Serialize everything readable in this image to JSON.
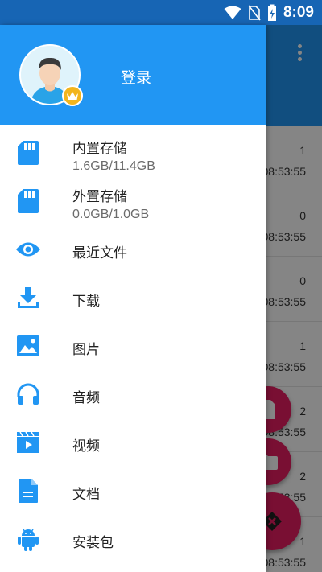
{
  "status_bar": {
    "time": "8:09",
    "icons": [
      "wifi-icon",
      "no-sim-icon",
      "battery-charging-icon"
    ]
  },
  "colors": {
    "primary": "#2196f3",
    "status_bar": "#1765b4",
    "accent": "#e91e63",
    "badge": "#f2b51d"
  },
  "background_list": {
    "rows": [
      {
        "count": "1",
        "time": "08:53:55"
      },
      {
        "count": "0",
        "time": "08:53:55"
      },
      {
        "count": "0",
        "time": "08:53:55"
      },
      {
        "count": "1",
        "time": "08:53:55"
      },
      {
        "count": "2",
        "time": "08:53:55"
      },
      {
        "count": "2",
        "time": "08:53:55"
      },
      {
        "count": "1",
        "time": "08:53:55"
      }
    ]
  },
  "drawer": {
    "login_label": "登录",
    "items": [
      {
        "label": "内置存储",
        "sub": "1.6GB/11.4GB",
        "icon": "sd-card-icon"
      },
      {
        "label": "外置存储",
        "sub": "0.0GB/1.0GB",
        "icon": "sd-card-icon"
      },
      {
        "label": "最近文件",
        "icon": "eye-icon"
      },
      {
        "label": "下载",
        "icon": "download-icon"
      },
      {
        "label": "图片",
        "icon": "image-icon"
      },
      {
        "label": "音频",
        "icon": "headphones-icon"
      },
      {
        "label": "视频",
        "icon": "video-icon"
      },
      {
        "label": "文档",
        "icon": "document-icon"
      },
      {
        "label": "安装包",
        "icon": "android-icon"
      }
    ]
  }
}
